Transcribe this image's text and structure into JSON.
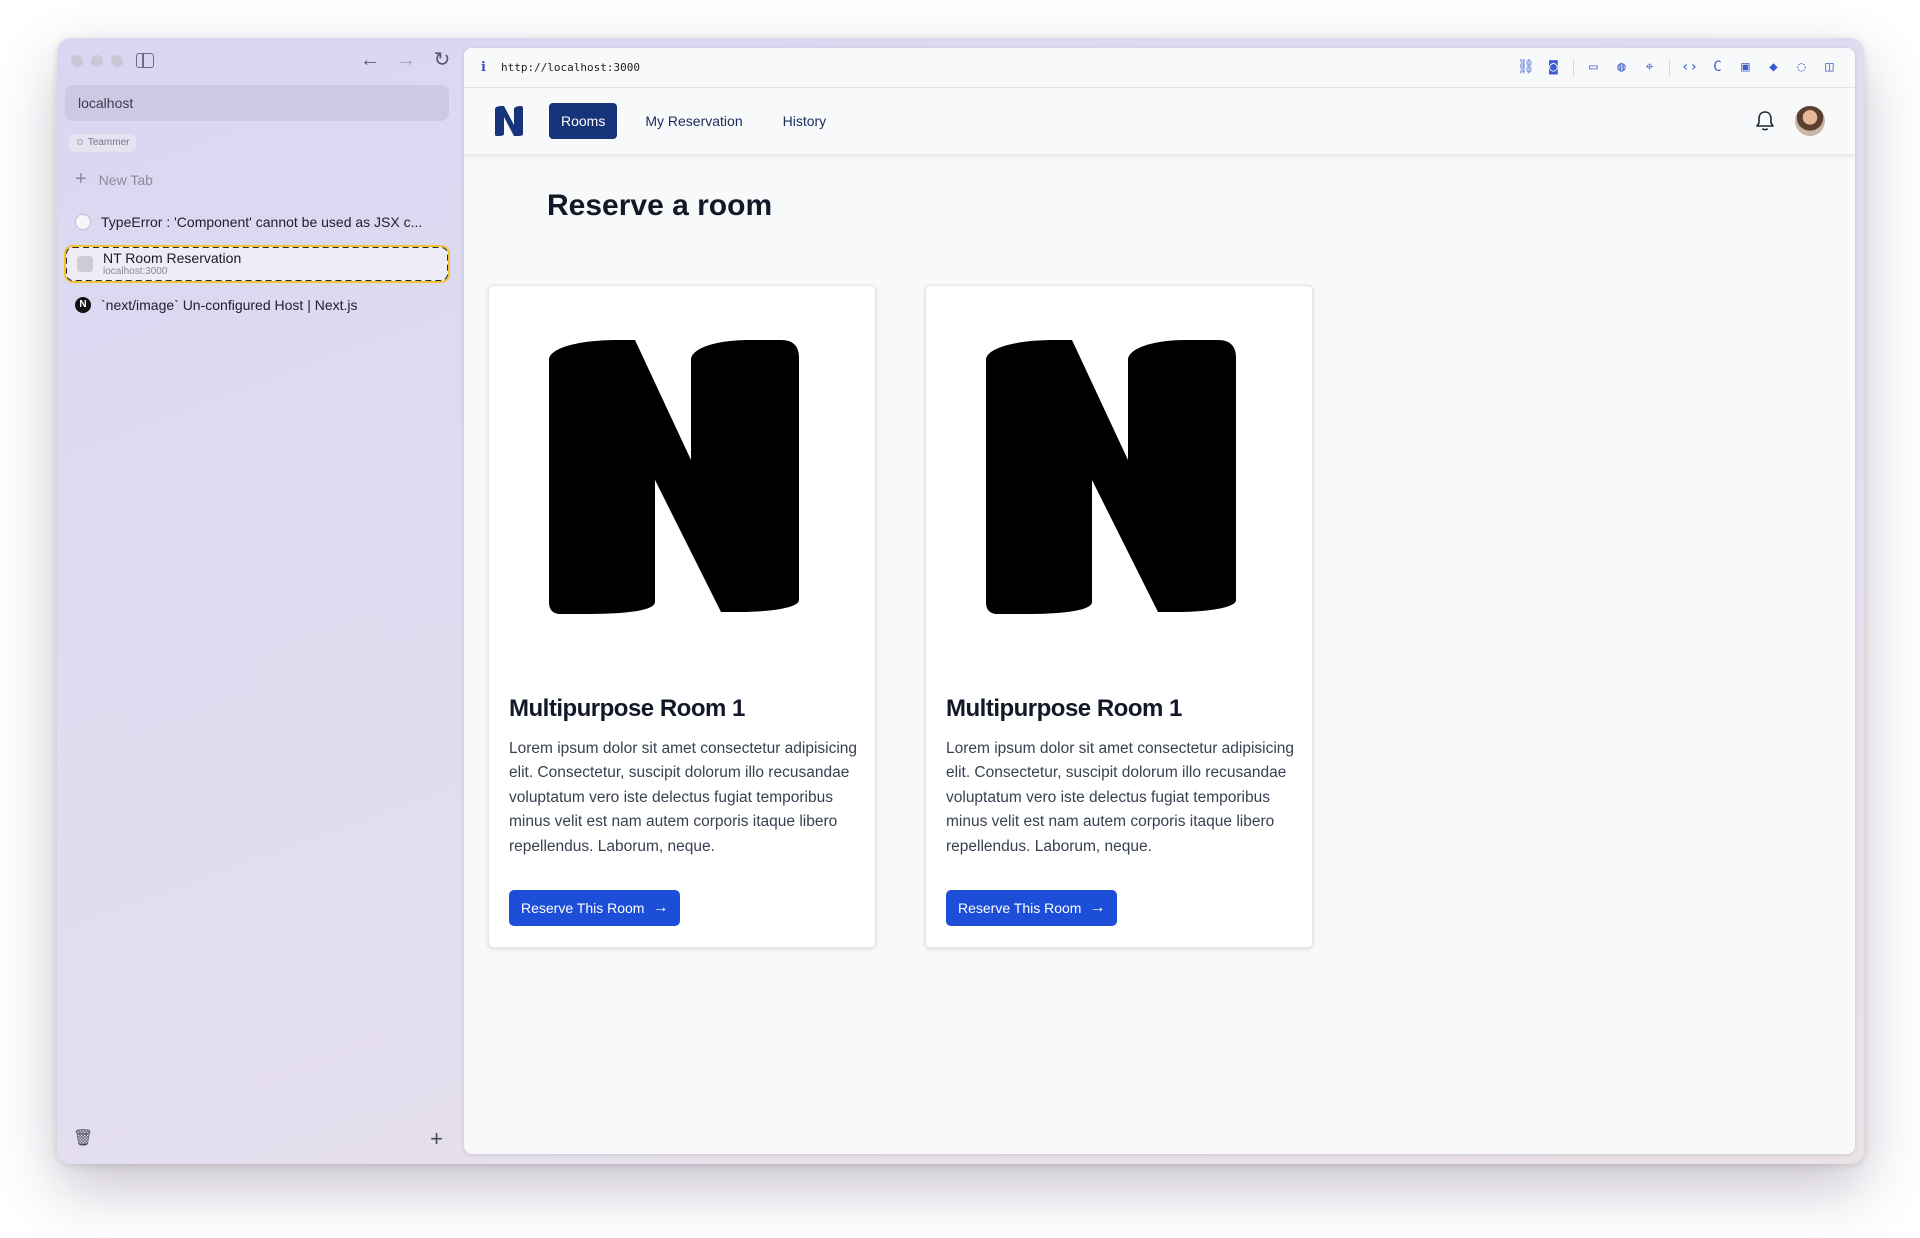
{
  "sidebar": {
    "url": "localhost",
    "space_label": "Teammer",
    "new_tab_label": "New Tab",
    "tabs": [
      {
        "title": "TypeError : 'Component' cannot be used as JSX c..."
      },
      {
        "title": "NT Room Reservation",
        "subtitle": "localhost:3000"
      },
      {
        "title": "`next/image` Un-configured Host | Next.js"
      }
    ]
  },
  "addressbar": {
    "info_icon": "i",
    "url": "http://localhost:3000"
  },
  "navbar": {
    "links": [
      "Rooms",
      "My Reservation",
      "History"
    ],
    "active": "Rooms"
  },
  "page": {
    "title": "Reserve a room",
    "rooms": [
      {
        "name": "Multipurpose Room 1",
        "description": "Lorem ipsum dolor sit amet consectetur adipisicing elit. Consectetur, suscipit dolorum illo recusandae voluptatum vero iste delectus fugiat temporibus minus velit est nam autem corporis itaque libero repellendus. Laborum, neque.",
        "button": "Reserve This Room"
      },
      {
        "name": "Multipurpose Room 1",
        "description": "Lorem ipsum dolor sit amet consectetur adipisicing elit. Consectetur, suscipit dolorum illo recusandae voluptatum vero iste delectus fugiat temporibus minus velit est nam autem corporis itaque libero repellendus. Laborum, neque.",
        "button": "Reserve This Room"
      }
    ]
  },
  "colors": {
    "brand_navy": "#17337a",
    "button_blue": "#1d4ed8",
    "title_text": "#111827"
  }
}
